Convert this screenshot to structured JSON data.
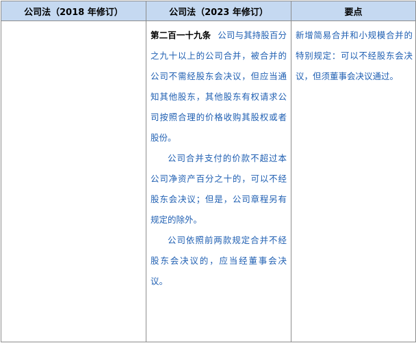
{
  "header": {
    "col_2018": "公司法（2018 年修订）",
    "col_2023": "公司法（2023 年修订）",
    "col_points": "要点"
  },
  "row": {
    "law_2018": "",
    "article_no": "第二百一十九条",
    "para1": "公司与其持股百分之九十以上的公司合并，被合并的公司不需经股东会决议，但应当通知其他股东，其他股东有权请求公司按照合理的价格收购其股权或者股份。",
    "para2": "公司合并支付的价款不超过本公司净资产百分之十的，可以不经股东会决议；但是，公司章程另有规定的除外。",
    "para3": "公司依照前两款规定合并不经股东会决议的，应当经董事会决议。",
    "points": "新增简易合并和小规模合并的特别规定：可以不经股东会决议，但须董事会决议通过。"
  },
  "colors": {
    "header_bg": "#c5d9f1",
    "text_blue": "#1f5fb2",
    "border": "#8c8c8c"
  }
}
